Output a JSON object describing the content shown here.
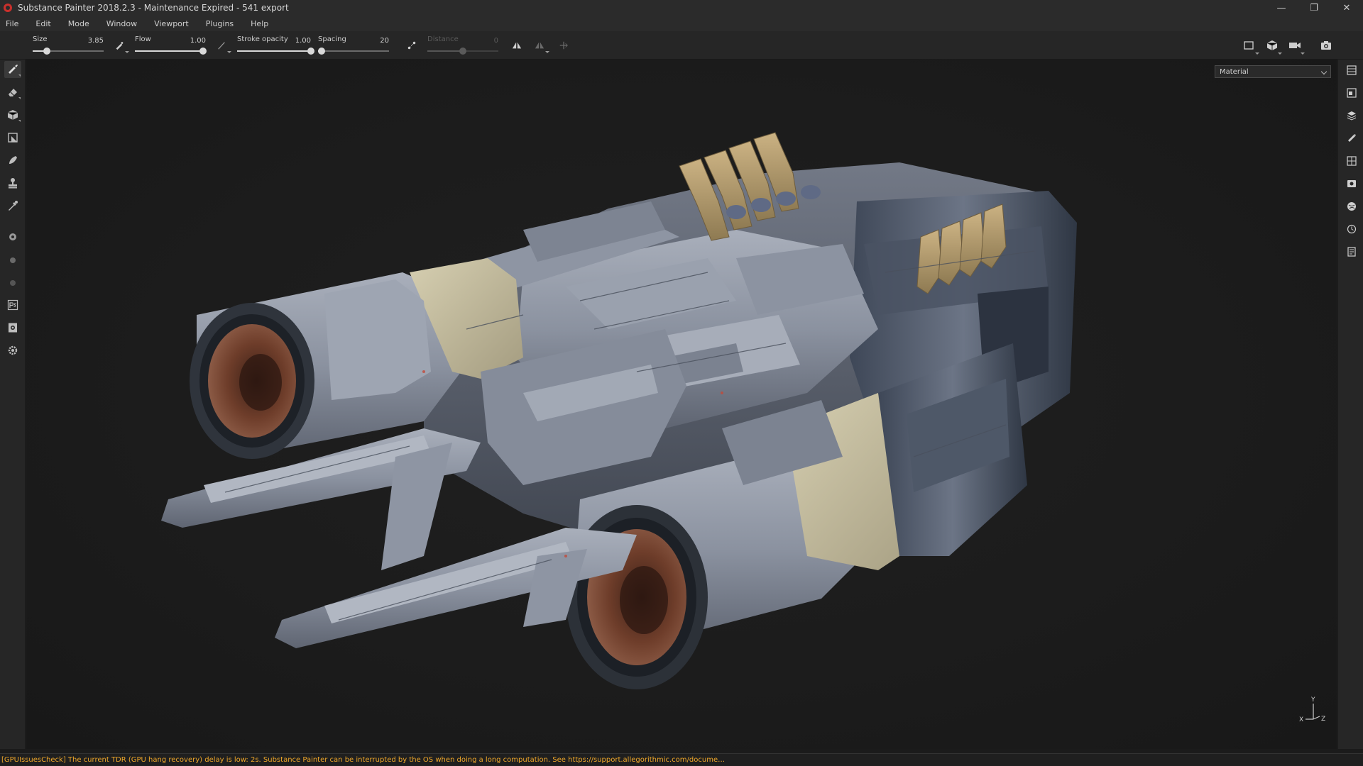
{
  "window": {
    "title": "Substance Painter 2018.2.3 - Maintenance Expired - 541 export",
    "minimize": "—",
    "restore": "❐",
    "close": "✕"
  },
  "menu": [
    "File",
    "Edit",
    "Mode",
    "Window",
    "Viewport",
    "Plugins",
    "Help"
  ],
  "tool_properties": {
    "size": {
      "label": "Size",
      "value": "3.85",
      "fraction": 0.2
    },
    "flow": {
      "label": "Flow",
      "value": "1.00",
      "fraction": 1.0
    },
    "stroke_opacity": {
      "label": "Stroke opacity",
      "value": "1.00",
      "fraction": 1.0
    },
    "spacing": {
      "label": "Spacing",
      "value": "20",
      "fraction": 0.05
    },
    "distance": {
      "label": "Distance",
      "value": "0",
      "fraction": 0.5,
      "disabled": true
    }
  },
  "viewport": {
    "channel_dropdown": "Material",
    "axis_labels": {
      "y": "Y",
      "x": "X",
      "z": "Z"
    }
  },
  "left_tools": [
    "paint-brush-icon",
    "eraser-icon",
    "projection-icon",
    "polygon-fill-icon",
    "smudge-icon",
    "clone-stamp-icon",
    "color-picker-icon",
    "bake-icon",
    "material-ball-icon",
    "sphere-icon",
    "photoshop-export-icon",
    "export-textures-icon",
    "settings-icon"
  ],
  "right_tools": [
    "layers-icon",
    "texture-set-list-icon",
    "texture-set-settings-icon",
    "properties-icon",
    "display-settings-icon",
    "viewer-settings-icon",
    "shelf-icon",
    "history-icon",
    "log-icon"
  ],
  "status": {
    "message": "[GPUIssuesCheck] The current TDR (GPU hang recovery) delay is low: 2s. Substance Painter can be interrupted by the OS when doing a long computation. See https://support.allegorithmic.com/docume…"
  },
  "colors": {
    "accent_warning": "#f0a82a",
    "hull_metal": "#8d94a3",
    "cream_panel": "#c9c1a3",
    "tan_fins": "#b49a6a",
    "exhaust_copper": "#6b3a2a"
  }
}
